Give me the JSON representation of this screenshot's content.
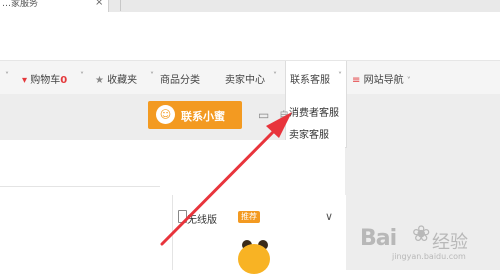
{
  "browser": {
    "tab_title": "…家服务",
    "tab_close": "×"
  },
  "nav": {
    "cart_label": "购物车",
    "cart_count": "0",
    "favorites_label": "收藏夹",
    "category_label": "商品分类",
    "seller_center_label": "卖家中心",
    "contact_service_label": "联系客服",
    "site_nav_label": "网站导航",
    "arrow": "˅"
  },
  "dropdown": {
    "items": [
      "消费者客服",
      "卖家客服"
    ]
  },
  "contact_button": {
    "label": "联系小蜜",
    "icon_glyph": "☺"
  },
  "monitor_peek": "自",
  "wireless": {
    "label": "无线版",
    "badge": "推荐",
    "chevron": "∨"
  },
  "watermark": {
    "brand": "Bai",
    "brand2": "经验",
    "url": "jingyan.baidu.com"
  },
  "colors": {
    "accent": "#f39a21",
    "annotation_arrow": "#e8343c",
    "cart_red": "#e4393c"
  }
}
